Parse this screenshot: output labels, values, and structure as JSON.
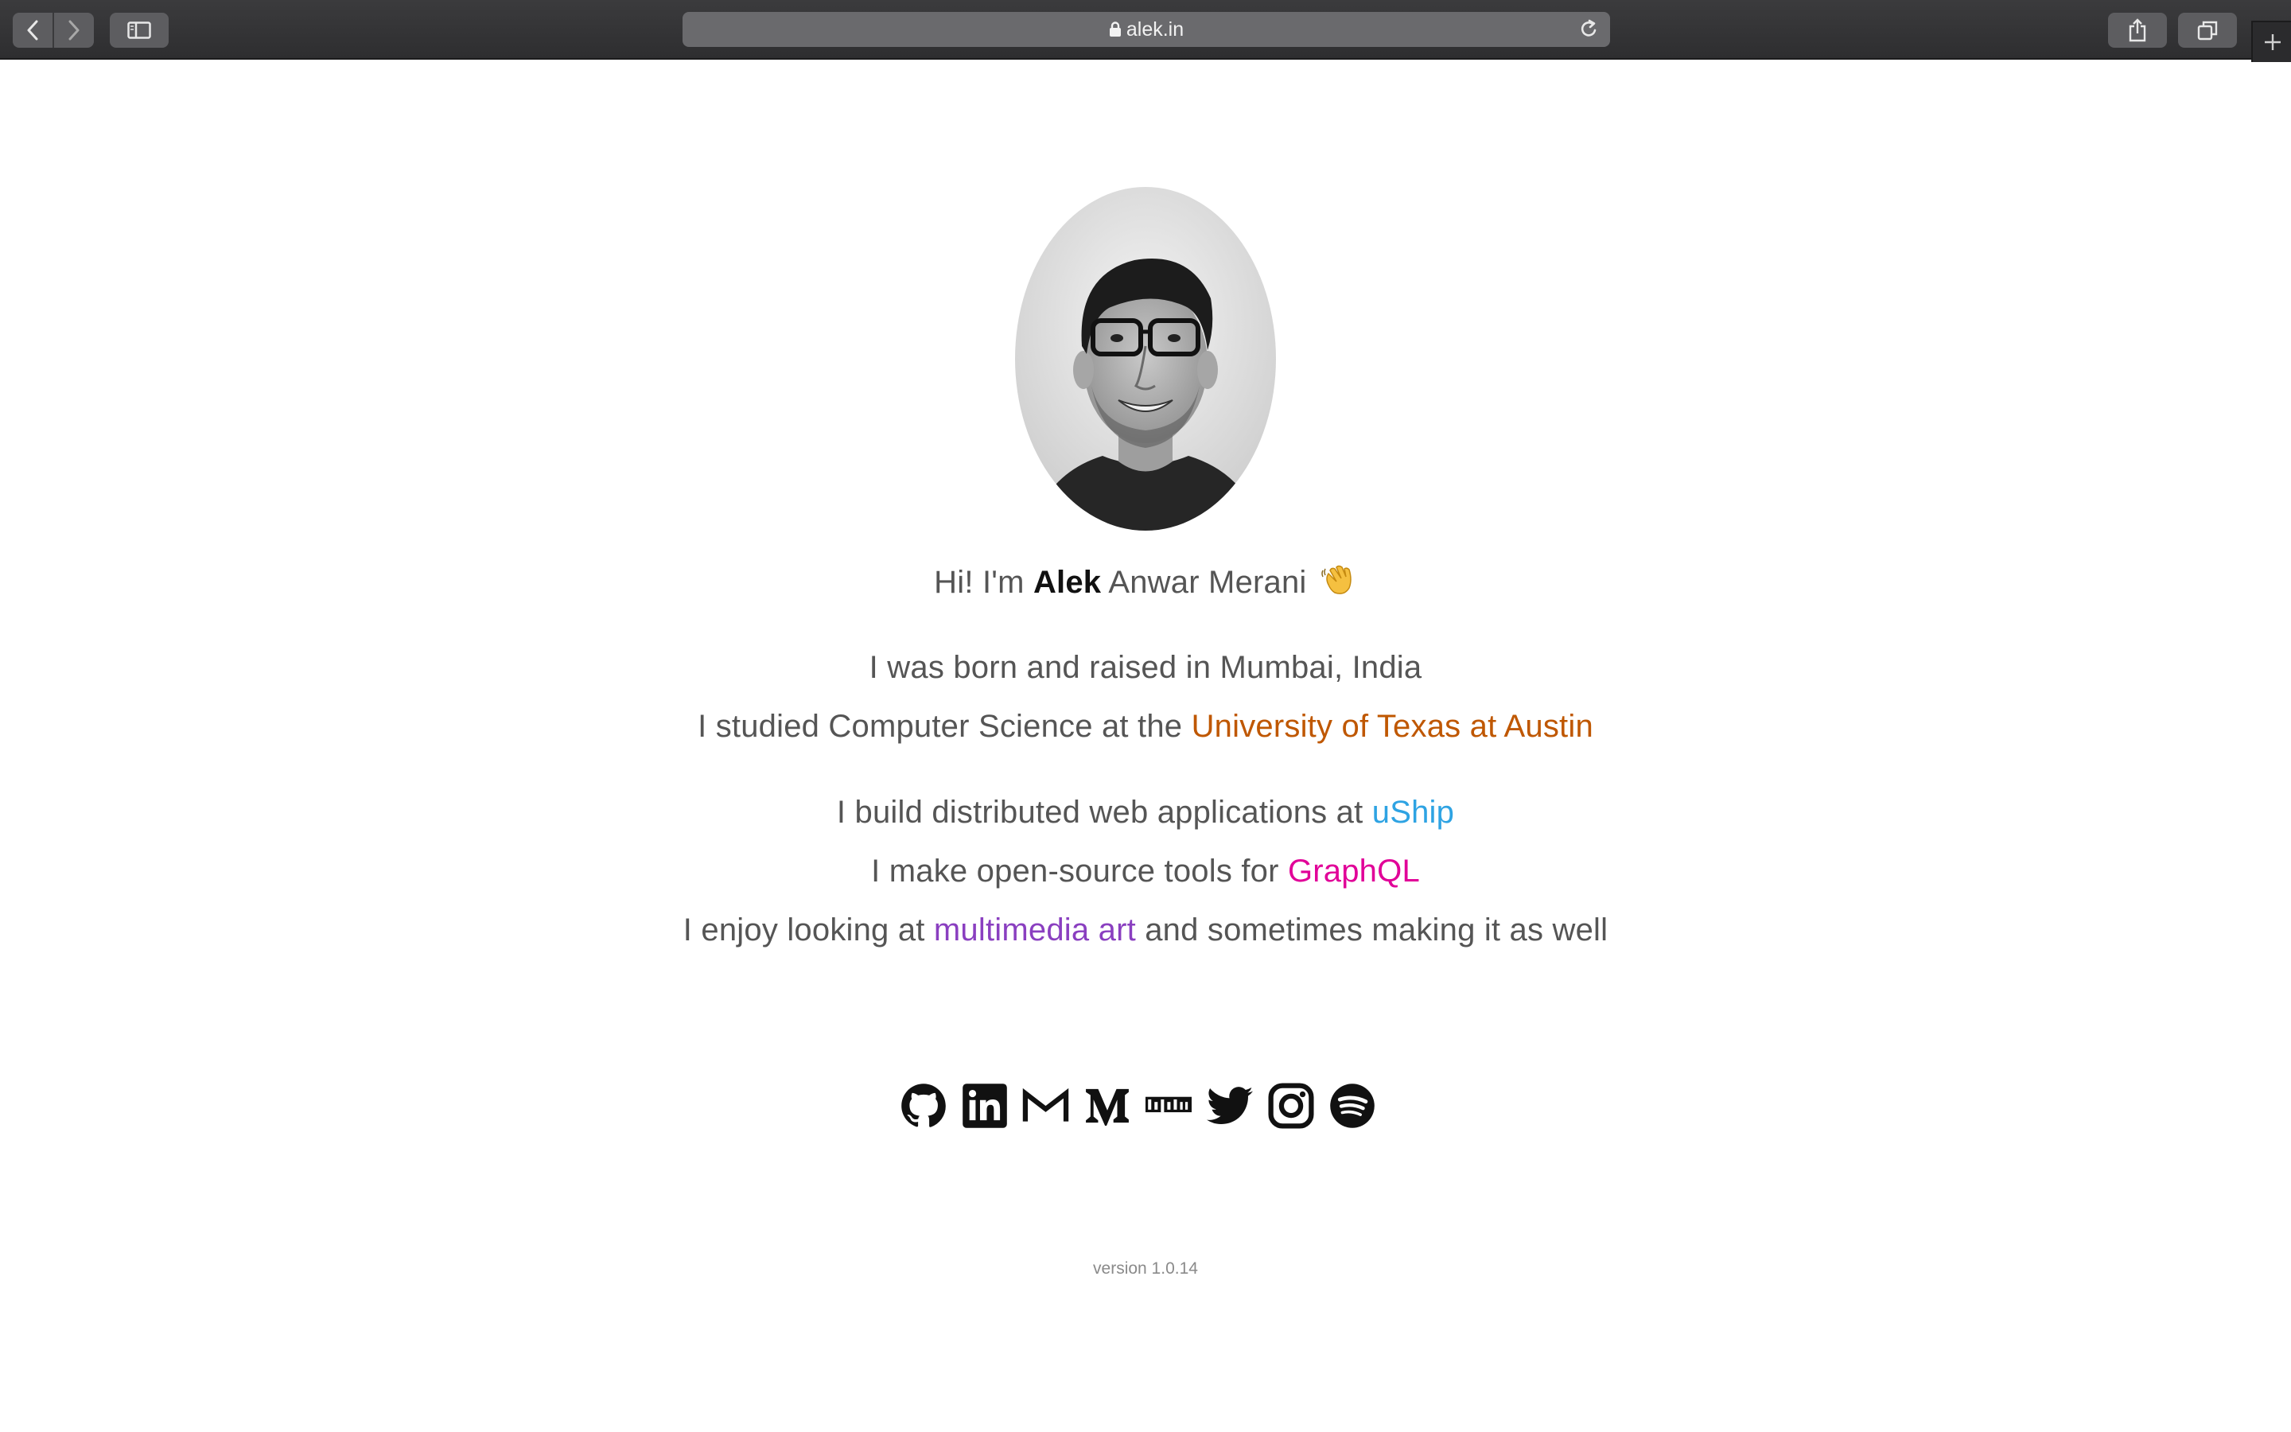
{
  "browser": {
    "url": "alek.in"
  },
  "profile": {
    "greeting_prefix": "Hi! I'm",
    "first_name": "Alek",
    "rest_name": "Anwar Merani",
    "wave_emoji": "waving-hand"
  },
  "bio": {
    "line1": "I was born and raised in Mumbai, India",
    "line2_prefix": "I studied Computer Science at the",
    "line2_link": "University of Texas at Austin",
    "line3_prefix": "I build distributed web applications at",
    "line3_link": "uShip",
    "line4_prefix": "I make open-source tools for",
    "line4_link": "GraphQL",
    "line5_prefix": "I enjoy looking at",
    "line5_link": "multimedia art",
    "line5_suffix": "and sometimes making it as well"
  },
  "colors": {
    "utexas": "#bf5700",
    "uship": "#2ea3e3",
    "graphql": "#e10098",
    "art": "#8a3fc0"
  },
  "socials": [
    "github-icon",
    "linkedin-icon",
    "gmail-icon",
    "medium-icon",
    "npm-icon",
    "twitter-icon",
    "instagram-icon",
    "spotify-icon"
  ],
  "footer": {
    "version": "version 1.0.14"
  }
}
